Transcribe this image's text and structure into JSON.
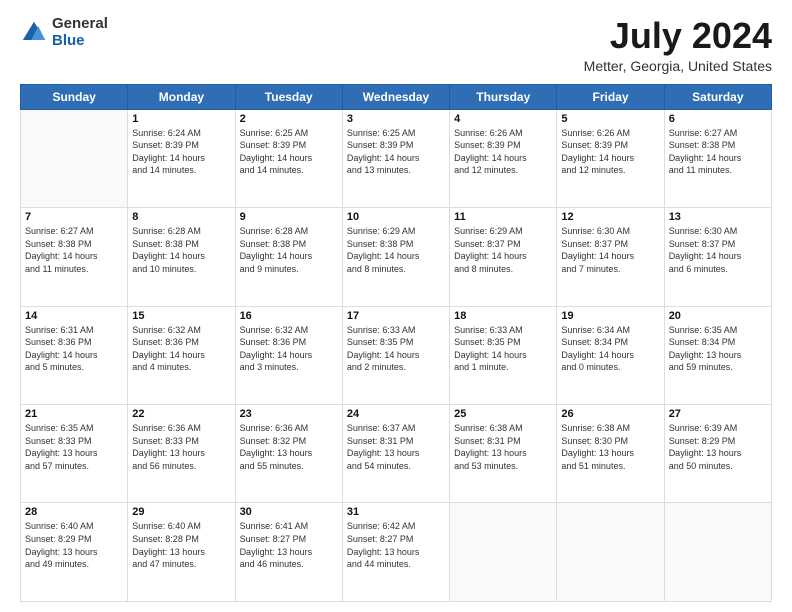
{
  "logo": {
    "general": "General",
    "blue": "Blue"
  },
  "title": "July 2024",
  "subtitle": "Metter, Georgia, United States",
  "days_of_week": [
    "Sunday",
    "Monday",
    "Tuesday",
    "Wednesday",
    "Thursday",
    "Friday",
    "Saturday"
  ],
  "weeks": [
    [
      {
        "day": "",
        "info": ""
      },
      {
        "day": "1",
        "info": "Sunrise: 6:24 AM\nSunset: 8:39 PM\nDaylight: 14 hours\nand 14 minutes."
      },
      {
        "day": "2",
        "info": "Sunrise: 6:25 AM\nSunset: 8:39 PM\nDaylight: 14 hours\nand 14 minutes."
      },
      {
        "day": "3",
        "info": "Sunrise: 6:25 AM\nSunset: 8:39 PM\nDaylight: 14 hours\nand 13 minutes."
      },
      {
        "day": "4",
        "info": "Sunrise: 6:26 AM\nSunset: 8:39 PM\nDaylight: 14 hours\nand 12 minutes."
      },
      {
        "day": "5",
        "info": "Sunrise: 6:26 AM\nSunset: 8:39 PM\nDaylight: 14 hours\nand 12 minutes."
      },
      {
        "day": "6",
        "info": "Sunrise: 6:27 AM\nSunset: 8:38 PM\nDaylight: 14 hours\nand 11 minutes."
      }
    ],
    [
      {
        "day": "7",
        "info": "Sunrise: 6:27 AM\nSunset: 8:38 PM\nDaylight: 14 hours\nand 11 minutes."
      },
      {
        "day": "8",
        "info": "Sunrise: 6:28 AM\nSunset: 8:38 PM\nDaylight: 14 hours\nand 10 minutes."
      },
      {
        "day": "9",
        "info": "Sunrise: 6:28 AM\nSunset: 8:38 PM\nDaylight: 14 hours\nand 9 minutes."
      },
      {
        "day": "10",
        "info": "Sunrise: 6:29 AM\nSunset: 8:38 PM\nDaylight: 14 hours\nand 8 minutes."
      },
      {
        "day": "11",
        "info": "Sunrise: 6:29 AM\nSunset: 8:37 PM\nDaylight: 14 hours\nand 8 minutes."
      },
      {
        "day": "12",
        "info": "Sunrise: 6:30 AM\nSunset: 8:37 PM\nDaylight: 14 hours\nand 7 minutes."
      },
      {
        "day": "13",
        "info": "Sunrise: 6:30 AM\nSunset: 8:37 PM\nDaylight: 14 hours\nand 6 minutes."
      }
    ],
    [
      {
        "day": "14",
        "info": "Sunrise: 6:31 AM\nSunset: 8:36 PM\nDaylight: 14 hours\nand 5 minutes."
      },
      {
        "day": "15",
        "info": "Sunrise: 6:32 AM\nSunset: 8:36 PM\nDaylight: 14 hours\nand 4 minutes."
      },
      {
        "day": "16",
        "info": "Sunrise: 6:32 AM\nSunset: 8:36 PM\nDaylight: 14 hours\nand 3 minutes."
      },
      {
        "day": "17",
        "info": "Sunrise: 6:33 AM\nSunset: 8:35 PM\nDaylight: 14 hours\nand 2 minutes."
      },
      {
        "day": "18",
        "info": "Sunrise: 6:33 AM\nSunset: 8:35 PM\nDaylight: 14 hours\nand 1 minute."
      },
      {
        "day": "19",
        "info": "Sunrise: 6:34 AM\nSunset: 8:34 PM\nDaylight: 14 hours\nand 0 minutes."
      },
      {
        "day": "20",
        "info": "Sunrise: 6:35 AM\nSunset: 8:34 PM\nDaylight: 13 hours\nand 59 minutes."
      }
    ],
    [
      {
        "day": "21",
        "info": "Sunrise: 6:35 AM\nSunset: 8:33 PM\nDaylight: 13 hours\nand 57 minutes."
      },
      {
        "day": "22",
        "info": "Sunrise: 6:36 AM\nSunset: 8:33 PM\nDaylight: 13 hours\nand 56 minutes."
      },
      {
        "day": "23",
        "info": "Sunrise: 6:36 AM\nSunset: 8:32 PM\nDaylight: 13 hours\nand 55 minutes."
      },
      {
        "day": "24",
        "info": "Sunrise: 6:37 AM\nSunset: 8:31 PM\nDaylight: 13 hours\nand 54 minutes."
      },
      {
        "day": "25",
        "info": "Sunrise: 6:38 AM\nSunset: 8:31 PM\nDaylight: 13 hours\nand 53 minutes."
      },
      {
        "day": "26",
        "info": "Sunrise: 6:38 AM\nSunset: 8:30 PM\nDaylight: 13 hours\nand 51 minutes."
      },
      {
        "day": "27",
        "info": "Sunrise: 6:39 AM\nSunset: 8:29 PM\nDaylight: 13 hours\nand 50 minutes."
      }
    ],
    [
      {
        "day": "28",
        "info": "Sunrise: 6:40 AM\nSunset: 8:29 PM\nDaylight: 13 hours\nand 49 minutes."
      },
      {
        "day": "29",
        "info": "Sunrise: 6:40 AM\nSunset: 8:28 PM\nDaylight: 13 hours\nand 47 minutes."
      },
      {
        "day": "30",
        "info": "Sunrise: 6:41 AM\nSunset: 8:27 PM\nDaylight: 13 hours\nand 46 minutes."
      },
      {
        "day": "31",
        "info": "Sunrise: 6:42 AM\nSunset: 8:27 PM\nDaylight: 13 hours\nand 44 minutes."
      },
      {
        "day": "",
        "info": ""
      },
      {
        "day": "",
        "info": ""
      },
      {
        "day": "",
        "info": ""
      }
    ]
  ]
}
